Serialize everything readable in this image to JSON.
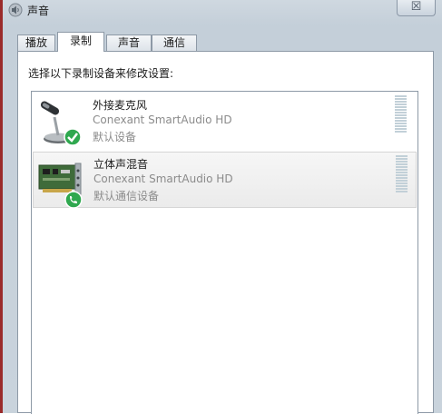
{
  "window": {
    "title": "声音",
    "close_symbol": "☒",
    "accent": "#9a2b2b"
  },
  "tabs": [
    {
      "label": "播放",
      "active": false
    },
    {
      "label": "录制",
      "active": true
    },
    {
      "label": "声音",
      "active": false
    },
    {
      "label": "通信",
      "active": false
    }
  ],
  "panel": {
    "instruction": "选择以下录制设备来修改设置:"
  },
  "devices": [
    {
      "name": "外接麦克风",
      "driver": "Conexant SmartAudio HD",
      "status": "默认设备",
      "icon": "microphone-icon",
      "badge": "check-badge-icon",
      "badge_color": "#2fa84f"
    },
    {
      "name": "立体声混音",
      "driver": "Conexant SmartAudio HD",
      "status": "默认通信设备",
      "icon": "sound-card-icon",
      "badge": "phone-badge-icon",
      "badge_color": "#2fa84f"
    }
  ]
}
